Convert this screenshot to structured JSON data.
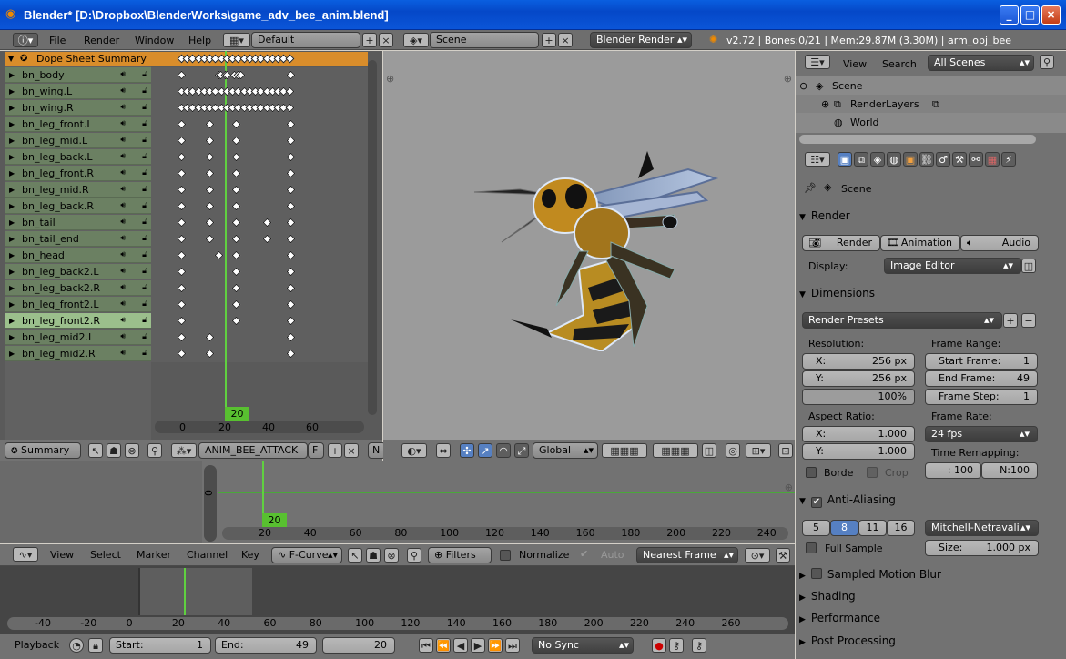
{
  "window": {
    "title": "Blender* [D:\\Dropbox\\BlenderWorks\\game_adv_bee_anim.blend]"
  },
  "info_header": {
    "menus": [
      "File",
      "Render",
      "Window",
      "Help"
    ],
    "layout": "Default",
    "scene": "Scene",
    "engine": "Blender Render",
    "stats": "v2.72 | Bones:0/21 | Mem:29.87M (3.30M) | arm_obj_bee"
  },
  "dopesheet": {
    "summary_label": "Dope Sheet Summary",
    "channels": [
      "bn_body",
      "bn_wing.L",
      "bn_wing.R",
      "bn_leg_front.L",
      "bn_leg_mid.L",
      "bn_leg_back.L",
      "bn_leg_front.R",
      "bn_leg_mid.R",
      "bn_leg_back.R",
      "bn_tail",
      "bn_tail_end",
      "bn_head",
      "bn_leg_back2.L",
      "bn_leg_back2.R",
      "bn_leg_front2.L",
      "bn_leg_front2.R",
      "bn_leg_mid2.L",
      "bn_leg_mid2.R"
    ],
    "current_frame": "20",
    "ruler": [
      "0",
      "20",
      "40",
      "60"
    ],
    "mode": "Summary",
    "action": "ANIM_BEE_ATTACK",
    "action_f": "F"
  },
  "viewport_header": {
    "n_label": "N",
    "orientation": "Global"
  },
  "outliner": {
    "menus": [
      "View",
      "Search"
    ],
    "filter": "All Scenes",
    "items": [
      "Scene",
      "RenderLayers",
      "World"
    ]
  },
  "properties": {
    "scene_label": "Scene",
    "render": {
      "title": "Render",
      "buttons": [
        "Render",
        "Animation",
        "Audio"
      ],
      "display_label": "Display:",
      "display_value": "Image Editor"
    },
    "dimensions": {
      "title": "Dimensions",
      "presets": "Render Presets",
      "resolution_label": "Resolution:",
      "res_x": {
        "label": "X:",
        "value": "256 px"
      },
      "res_y": {
        "label": "Y:",
        "value": "256 px"
      },
      "res_pct": "100%",
      "frame_range_label": "Frame Range:",
      "start": {
        "label": "Start Frame:",
        "value": "1"
      },
      "end": {
        "label": "End Frame:",
        "value": "49"
      },
      "step": {
        "label": "Frame Step:",
        "value": "1"
      },
      "aspect_label": "Aspect Ratio:",
      "asp_x": {
        "label": "X:",
        "value": "1.000"
      },
      "asp_y": {
        "label": "Y:",
        "value": "1.000"
      },
      "frame_rate_label": "Frame Rate:",
      "fps": "24 fps",
      "time_remap_label": "Time Remapping:",
      "remap_old": ": 100",
      "remap_new": "N:100",
      "border": "Borde",
      "crop": "Crop"
    },
    "aa": {
      "title": "Anti-Aliasing",
      "samples": [
        "5",
        "8",
        "11",
        "16"
      ],
      "filter": "Mitchell-Netravali",
      "full_sample": "Full Sample",
      "size_label": "Size:",
      "size_value": "1.000 px"
    },
    "collapsed": [
      "Sampled Motion Blur",
      "Shading",
      "Performance",
      "Post Processing"
    ]
  },
  "graph": {
    "current_frame": "20",
    "ruler": [
      "20",
      "40",
      "60",
      "80",
      "100",
      "120",
      "140",
      "160",
      "180",
      "200",
      "220",
      "240"
    ],
    "y_label": "0",
    "menus": [
      "View",
      "Select",
      "Marker",
      "Channel",
      "Key"
    ],
    "mode": "F-Curve",
    "filters": "Filters",
    "normalize": "Normalize",
    "auto": "Auto",
    "snap": "Nearest Frame"
  },
  "timeline": {
    "ruler": [
      "-40",
      "-20",
      "0",
      "20",
      "40",
      "60",
      "80",
      "100",
      "120",
      "140",
      "160",
      "180",
      "200",
      "220",
      "240",
      "260"
    ],
    "playback": "Playback",
    "start": {
      "label": "Start:",
      "value": "1"
    },
    "end": {
      "label": "End:",
      "value": "49"
    },
    "frame": "20",
    "sync": "No Sync"
  }
}
